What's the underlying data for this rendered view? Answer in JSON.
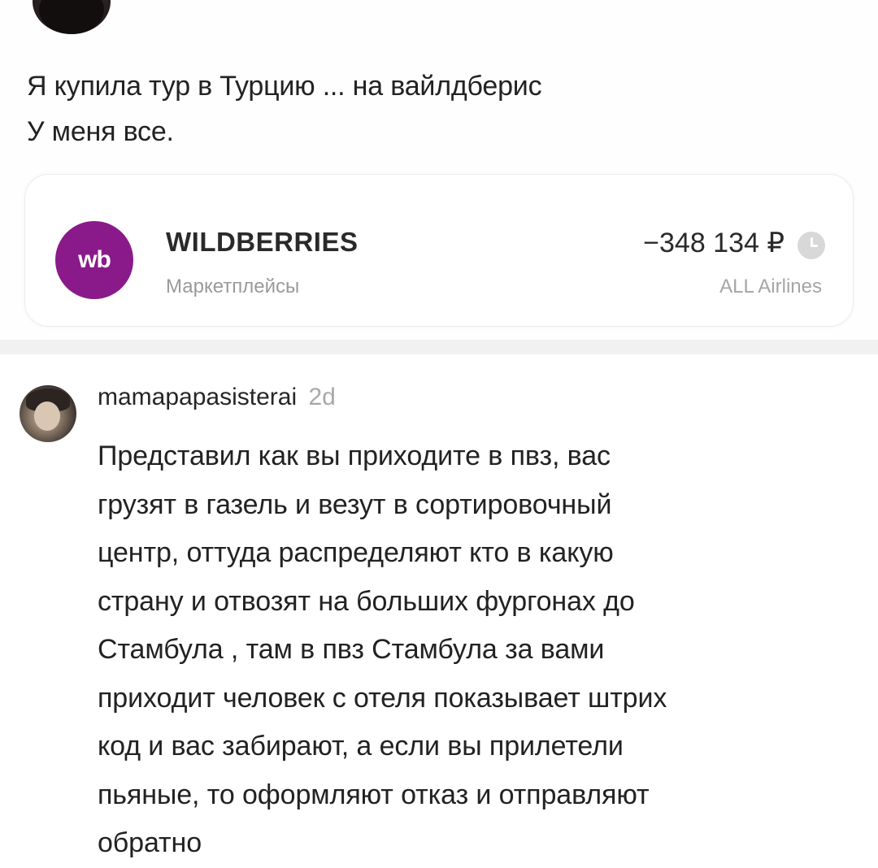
{
  "post": {
    "lines": [
      "Я купила тур в Турцию ... на вайлдберис",
      "У меня все."
    ],
    "transaction": {
      "merchant": "WILDBERRIES",
      "category": "Маркетплейсы",
      "amount": "−348 134 ₽",
      "note": "ALL Airlines",
      "logo_text": "wb",
      "brand_color": "#8a1a8a",
      "status_icon": "clock-icon"
    }
  },
  "comment": {
    "username": "mamapapasisterai",
    "time": "2d",
    "lines": [
      "Представил как вы приходите в пвз, вас",
      "грузят в газель и везут в сортировочный",
      "центр, оттуда распределяют кто в какую",
      "страну и отвозят на больших фургонах до",
      "Стамбула , там в пвз Стамбула за вами",
      "приходит человек с отеля показывает штрих",
      "код и вас забирают, а если вы прилетели",
      "пьяные, то оформляют отказ и отправляют",
      "обратно"
    ]
  }
}
